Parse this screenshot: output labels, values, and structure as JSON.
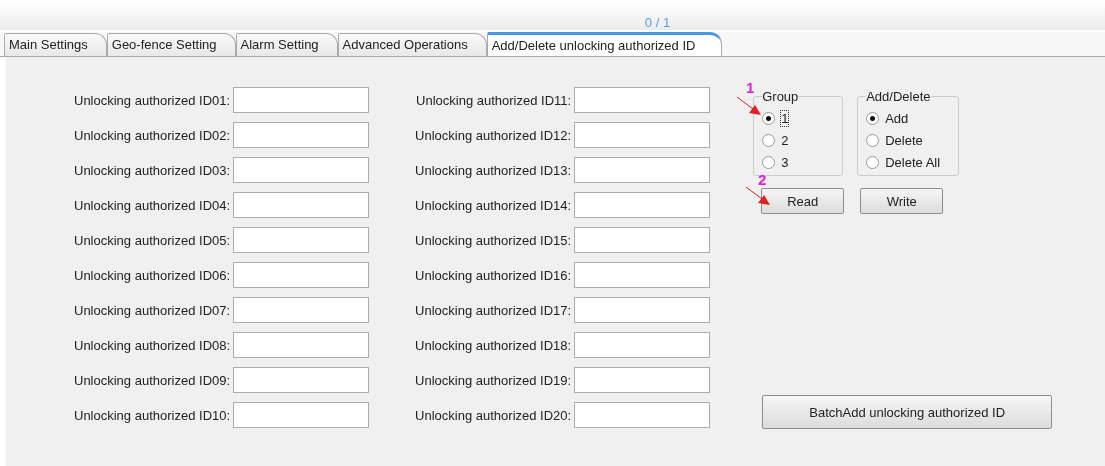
{
  "pager": "0 / 1",
  "tabs": [
    {
      "label": "Main Settings",
      "selected": false
    },
    {
      "label": "Geo-fence Setting",
      "selected": false
    },
    {
      "label": "Alarm Setting",
      "selected": false
    },
    {
      "label": "Advanced Operations",
      "selected": false
    },
    {
      "label": "Add/Delete unlocking authorized ID",
      "selected": true
    }
  ],
  "id_columns": [
    [
      {
        "label": "Unlocking authorized ID01:"
      },
      {
        "label": "Unlocking authorized ID02:"
      },
      {
        "label": "Unlocking authorized ID03:"
      },
      {
        "label": "Unlocking authorized ID04:"
      },
      {
        "label": "Unlocking authorized ID05:"
      },
      {
        "label": "Unlocking authorized ID06:"
      },
      {
        "label": "Unlocking authorized ID07:"
      },
      {
        "label": "Unlocking authorized ID08:"
      },
      {
        "label": "Unlocking authorized ID09:"
      },
      {
        "label": "Unlocking authorized ID10:"
      }
    ],
    [
      {
        "label": "Unlocking authorized ID11:"
      },
      {
        "label": "Unlocking authorized ID12:"
      },
      {
        "label": "Unlocking authorized ID13:"
      },
      {
        "label": "Unlocking authorized ID14:"
      },
      {
        "label": "Unlocking authorized ID15:"
      },
      {
        "label": "Unlocking authorized ID16:"
      },
      {
        "label": "Unlocking authorized ID17:"
      },
      {
        "label": "Unlocking authorized ID18:"
      },
      {
        "label": "Unlocking authorized ID19:"
      },
      {
        "label": "Unlocking authorized ID20:"
      }
    ]
  ],
  "groups": [
    {
      "title": "Group",
      "options": [
        {
          "label": "1",
          "selected": true,
          "focused": true
        },
        {
          "label": "2",
          "selected": false
        },
        {
          "label": "3",
          "selected": false
        }
      ]
    },
    {
      "title": "Add/Delete",
      "options": [
        {
          "label": "Add",
          "selected": true
        },
        {
          "label": "Delete",
          "selected": false
        },
        {
          "label": "Delete All",
          "selected": false
        }
      ]
    }
  ],
  "buttons": [
    "Read",
    "Write"
  ],
  "batch_button": "BatchAdd unlocking authorized ID",
  "annotations": [
    {
      "number": "1"
    },
    {
      "number": "2"
    }
  ]
}
